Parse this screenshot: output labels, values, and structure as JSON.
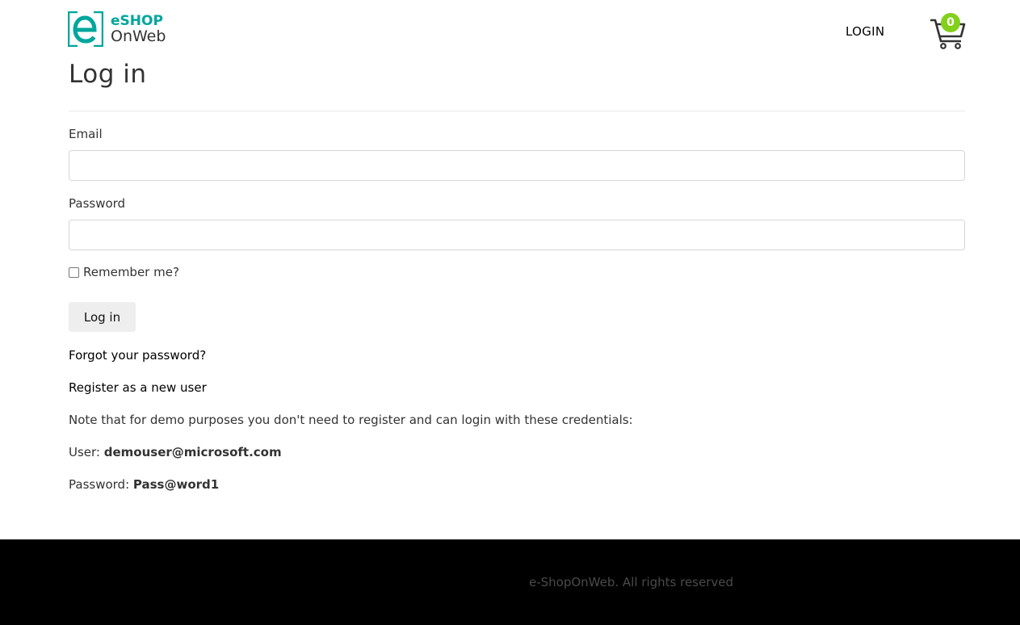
{
  "header": {
    "logo_line1": "eSHOP",
    "logo_line2": "OnWeb",
    "login_label": "LOGIN",
    "cart_count": "0",
    "brand_color": "#00a69c",
    "badge_color": "#83d01b"
  },
  "main": {
    "title": "Log in",
    "email_label": "Email",
    "email_value": "",
    "password_label": "Password",
    "password_value": "",
    "remember_label": "Remember me?",
    "remember_checked": false,
    "submit_label": "Log in",
    "forgot_link": "Forgot your password?",
    "register_link": "Register as a new user",
    "note": "Note that for demo purposes you don't need to register and can login with these credentials:",
    "user_prefix": "User: ",
    "user_value": "demouser@microsoft.com",
    "password_prefix": "Password: ",
    "password_demo": "Pass@word1"
  },
  "footer": {
    "text": "e-ShopOnWeb. All rights reserved"
  }
}
